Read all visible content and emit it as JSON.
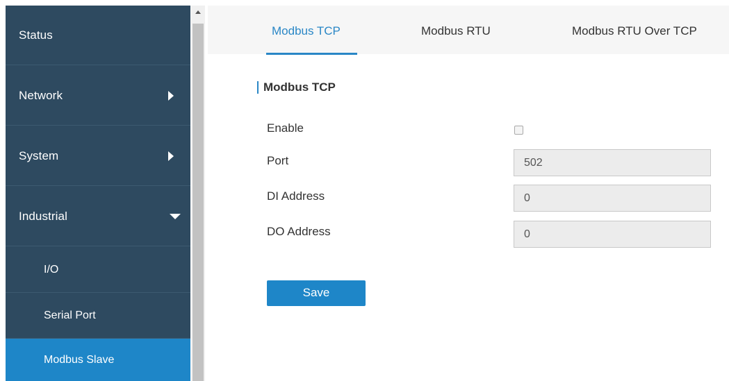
{
  "sidebar": {
    "items": [
      {
        "label": "Status"
      },
      {
        "label": "Network"
      },
      {
        "label": "System"
      },
      {
        "label": "Industrial"
      }
    ],
    "subitems": [
      {
        "label": "I/O"
      },
      {
        "label": "Serial Port"
      },
      {
        "label": "Modbus Slave",
        "active": true
      }
    ]
  },
  "tabs": [
    {
      "label": "Modbus TCP",
      "active": true
    },
    {
      "label": "Modbus RTU"
    },
    {
      "label": "Modbus RTU Over TCP"
    }
  ],
  "form": {
    "section_title": "Modbus TCP",
    "enable": {
      "label": "Enable",
      "checked": false
    },
    "port": {
      "label": "Port",
      "value": "502"
    },
    "di_address": {
      "label": "DI Address",
      "value": "0"
    },
    "do_address": {
      "label": "DO Address",
      "value": "0"
    },
    "save_label": "Save"
  },
  "colors": {
    "sidebar_bg": "#2e4a60",
    "accent": "#1e86c8",
    "tab_active": "#2a87c6"
  }
}
